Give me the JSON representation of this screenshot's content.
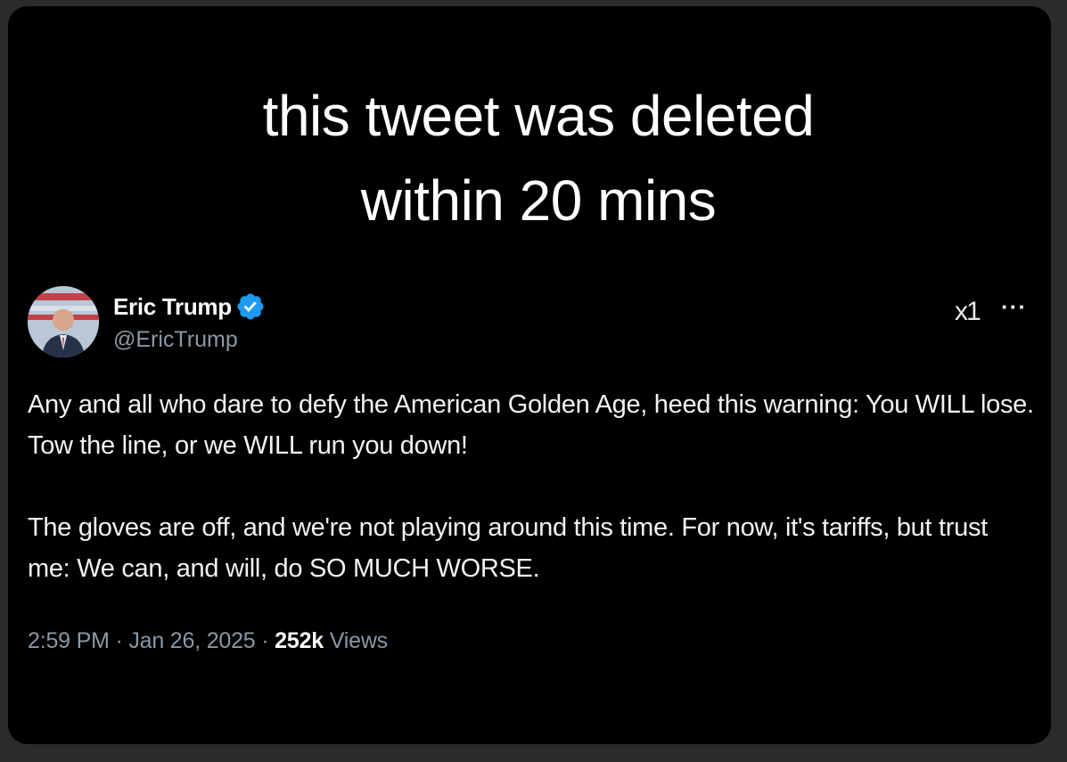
{
  "caption": {
    "line1": "this tweet was deleted",
    "line2": "within 20 mins"
  },
  "tweet": {
    "author": {
      "display_name": "Eric Trump",
      "handle": "@EricTrump",
      "verified": true,
      "verified_color": "#1d9bf0"
    },
    "header_icons": {
      "x_logo": "x-logo-icon",
      "x_logo_text": "x1",
      "more": "ellipsis-icon",
      "more_text": "···"
    },
    "paragraphs": [
      "Any and all who dare to defy the American Golden Age, heed this warning: You WILL lose. Tow the line, or we WILL run you down!",
      "The gloves are off, and we're not playing around this time. For now, it's tariffs, but trust me: We can, and will, do SO MUCH WORSE."
    ],
    "time": "2:59 PM",
    "date": "Jan 26, 2025",
    "separator": "·",
    "views_count": "252k",
    "views_label": "Views"
  },
  "colors": {
    "background": "#000000",
    "text": "#f2f2f2",
    "muted": "#8b98a5",
    "accent": "#1d9bf0"
  }
}
